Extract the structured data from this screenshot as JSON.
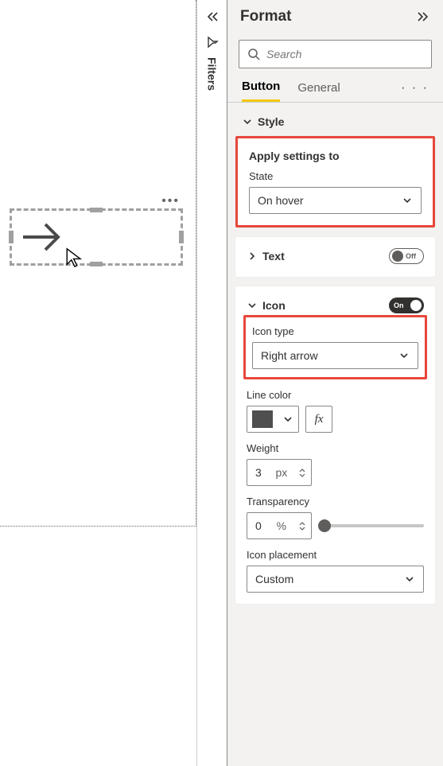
{
  "pane": {
    "title": "Format",
    "search_placeholder": "Search",
    "tabs": {
      "button": "Button",
      "general": "General"
    }
  },
  "filters_rail": {
    "label": "Filters"
  },
  "style": {
    "header": "Style",
    "apply_label": "Apply settings to",
    "state_label": "State",
    "state_value": "On hover"
  },
  "text_card": {
    "header": "Text",
    "toggle": "Off"
  },
  "icon_card": {
    "header": "Icon",
    "toggle": "On",
    "type_label": "Icon type",
    "type_value": "Right arrow",
    "line_color_label": "Line color",
    "weight_label": "Weight",
    "weight_value": "3",
    "weight_unit": "px",
    "transparency_label": "Transparency",
    "transparency_value": "0",
    "transparency_unit": "%",
    "placement_label": "Icon placement",
    "placement_value": "Custom"
  }
}
